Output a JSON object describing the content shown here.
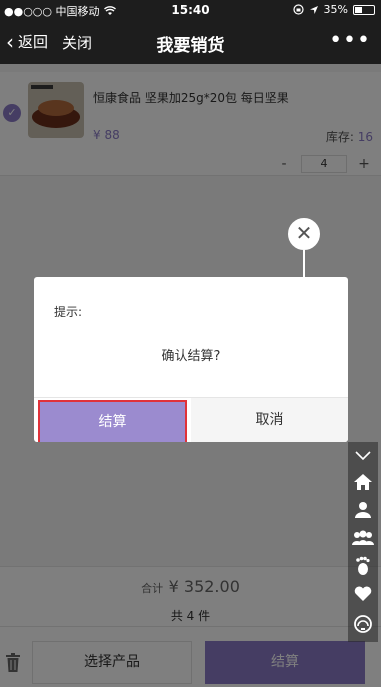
{
  "status_bar": {
    "carrier": "●●○○○ 中国移动",
    "time": "15:40",
    "battery": "35%"
  },
  "nav": {
    "back_label": "返回",
    "close_label": "关闭",
    "title": "我要销货",
    "more": "•••"
  },
  "product": {
    "name": "恒康食品 坚果加25g*20包 每日坚果",
    "price": "¥ 88",
    "stock_label": "库存:",
    "stock_value": "16",
    "qty_minus": "-",
    "qty_value": "4",
    "qty_plus": "+"
  },
  "totals": {
    "total_label": "合计",
    "total_amount": "¥ 352.00",
    "count_text": "共 4 件"
  },
  "bottom": {
    "select_label": "选择产品",
    "checkout_label": "结算"
  },
  "dialog": {
    "title": "提示:",
    "message": "确认结算?",
    "confirm_label": "结算",
    "cancel_label": "取消"
  },
  "colors": {
    "accent": "#8a7bc7",
    "highlight_border": "#e0323a",
    "bar_dark": "#1d1d1d"
  },
  "side_toolbar": {
    "icons": [
      "chevron-down-icon",
      "home-icon",
      "user-icon",
      "group-icon",
      "footprint-icon",
      "heart-icon",
      "support-icon"
    ]
  }
}
